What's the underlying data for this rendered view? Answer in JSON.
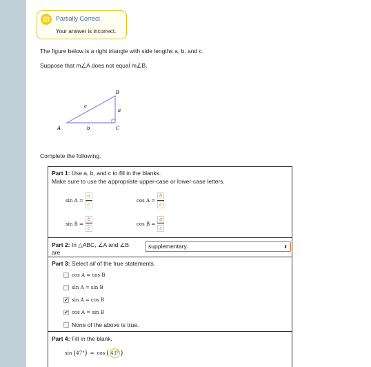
{
  "status": {
    "title": "Partially Correct",
    "message": "Your answer is incorrect."
  },
  "intro": {
    "line1": "The figure below is a right triangle with side lengths a, b, and c.",
    "line2": "Suppose that m∠A does not equal m∠B."
  },
  "triangle": {
    "vertex_a": "A",
    "vertex_b": "B",
    "vertex_c": "C",
    "side_a": "a",
    "side_b": "b",
    "side_c": "c"
  },
  "complete_label": "Complete the following.",
  "part1": {
    "heading": "Part 1:",
    "instruction": " Use a, b, and c to fill in the blanks.",
    "instruction2": "Make sure to use the appropriate upper-case or lower-case letters.",
    "sinA": {
      "label": "sin A =",
      "num": "a",
      "den": "c"
    },
    "cosA": {
      "label": "cos A =",
      "num": "b",
      "den": "c"
    },
    "sinB": {
      "label": "sin B =",
      "num": "b",
      "den": "c"
    },
    "cosB": {
      "label": "cos B =",
      "num": "a",
      "den": "c"
    }
  },
  "part2": {
    "heading": "Part 2:",
    "text": " In △ABC, ∠A and ∠B",
    "text2": "are",
    "selected": "supplementary."
  },
  "part3": {
    "heading": "Part 3:",
    "text_pre": " Select ",
    "text_em": "all",
    "text_post": " of the true statements.",
    "options": [
      {
        "label": "cos A = cos B",
        "checked": false
      },
      {
        "label": "sin A = sin B",
        "checked": false
      },
      {
        "label": "sin A = cos B",
        "checked": true
      },
      {
        "label": "cos A = sin B",
        "checked": true
      },
      {
        "label": "None of the above is true.",
        "checked": false
      }
    ]
  },
  "part4": {
    "heading": "Part 4:",
    "text": " Fill in the blank.",
    "lhs_fn": "sin",
    "lhs_angle": "47°",
    "eq": "=",
    "rhs_fn": "cos",
    "answer": "43°"
  },
  "colors": {
    "accent_orange": "#e06e2c",
    "status_yellow": "#f2c91a",
    "triangle_purple": "#8f86e0",
    "link_blue": "#3a6ab0"
  }
}
